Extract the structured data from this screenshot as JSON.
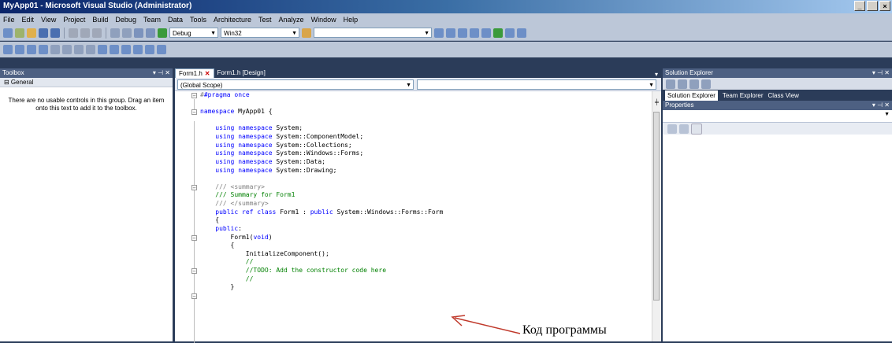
{
  "window": {
    "title": "MyApp01 - Microsoft Visual Studio (Administrator)",
    "controls": [
      "_",
      " ",
      "×"
    ]
  },
  "menu": [
    "File",
    "Edit",
    "View",
    "Project",
    "Build",
    "Debug",
    "Team",
    "Data",
    "Tools",
    "Architecture",
    "Test",
    "Analyze",
    "Window",
    "Help"
  ],
  "toolbar": {
    "config": "Debug",
    "platform": "Win32"
  },
  "toolbox": {
    "title": "Toolbox",
    "group": "⊟ General",
    "message": "There are no usable controls in this group. Drag an item onto this text to add it to the toolbox."
  },
  "editor": {
    "tabs": [
      "Form1.h",
      "Form1.h [Design]"
    ],
    "scope": "(Global Scope)"
  },
  "code": [
    "#pragma once",
    "",
    "namespace MyApp01 {",
    "",
    "    using namespace System;",
    "    using namespace System::ComponentModel;",
    "    using namespace System::Collections;",
    "    using namespace System::Windows::Forms;",
    "    using namespace System::Data;",
    "    using namespace System::Drawing;",
    "",
    "    /// <summary>",
    "    /// Summary for Form1",
    "    /// </summary>",
    "    public ref class Form1 : public System::Windows::Forms::Form",
    "    {",
    "    public:",
    "        Form1(void)",
    "        {",
    "            InitializeComponent();",
    "            //",
    "            //TODO: Add the constructor code here",
    "            //",
    "        }"
  ],
  "solution_explorer": {
    "title": "Solution Explorer",
    "tabs": [
      "Solution Explorer",
      "Team Explorer",
      "Class View"
    ]
  },
  "properties": {
    "title": "Properties"
  },
  "annotation": {
    "text": "Код программы",
    "color": "#c0392b"
  }
}
